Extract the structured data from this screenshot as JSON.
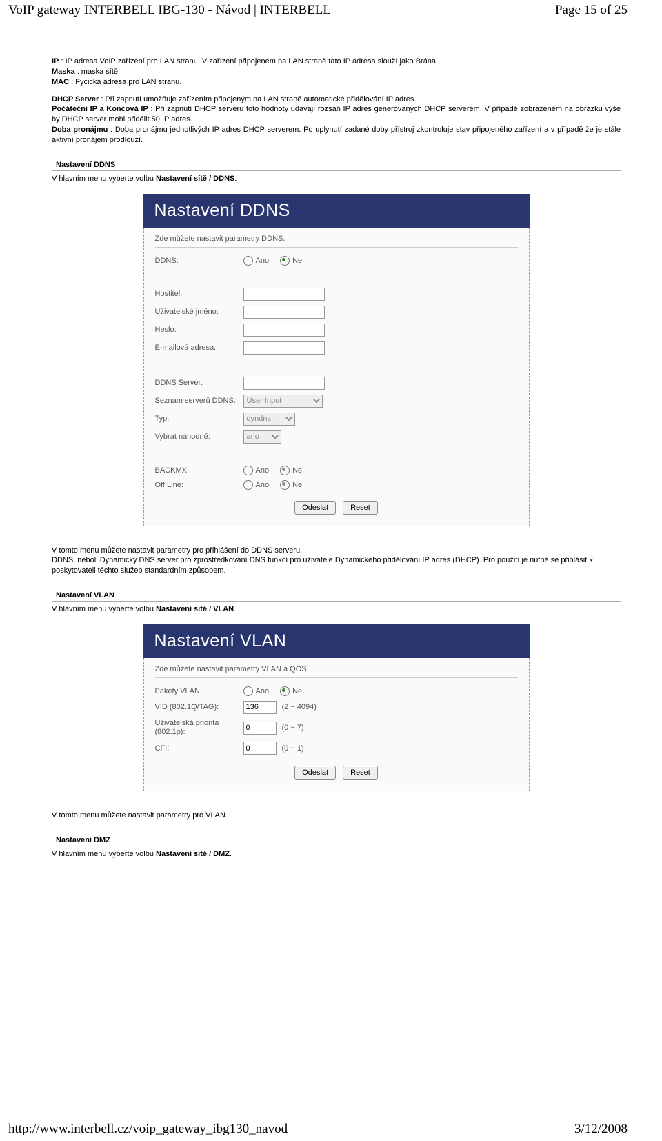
{
  "header": {
    "title": "VoIP gateway INTERBELL IBG-130 - Návod | INTERBELL",
    "page": "Page 15 of 25"
  },
  "intro": {
    "ip_label": "IP",
    "ip_text": " : IP adresa VoIP zařízení pro LAN stranu. V zařízení připojeném na LAN straně tato IP adresa slouží jako Brána.",
    "mask_label": "Maska",
    "mask_text": " : maska sítě.",
    "mac_label": "MAC",
    "mac_text": " : Fycická adresa pro LAN stranu.",
    "dhcp_label": "DHCP Server",
    "dhcp_text": " : Při zapnutí umožňuje zařízením připojeným na LAN straně automatické přidělování IP adres.",
    "range_label": "Počáteční IP a Koncová IP",
    "range_text": " : Při zapnutí DHCP serveru toto hodnoty udávají rozsah IP adres generovaných DHCP serverem. V případě zobrazeném na obrázku výše by DHCP server mohl přidělit 50 IP adres.",
    "lease_label": "Doba pronájmu",
    "lease_text": " : Doba pronájmu jednotlivých IP adres DHCP serverem. Po uplynutí zadané doby přístroj zkontroluje stav připojeného zařízení a v případě že je stále aktivní pronájem prodlouží."
  },
  "ddns": {
    "title": "Nastavení DDNS",
    "subtitle_pre": "V hlavním menu vyberte volbu ",
    "subtitle_bold": "Nastavení sítě / DDNS",
    "panel": {
      "heading": "Nastavení DDNS",
      "hint": "Zde můžete nastavit parametry DDNS.",
      "ddns_label": "DDNS:",
      "ano": "Ano",
      "ne": "Ne",
      "host": "Hostitel:",
      "user": "Uživatelské jméno:",
      "pass": "Heslo:",
      "email": "E-mailová adresa:",
      "server": "DDNS Server:",
      "list": "Seznam serverů DDNS:",
      "list_val": "User Input",
      "type": "Typ:",
      "type_val": "dyndns",
      "random": "Vybrat náhodně:",
      "random_val": "ano",
      "backmx": "BACKMX:",
      "offline": "Off Line:",
      "submit": "Odeslat",
      "reset": "Reset"
    },
    "para1": "V tomto menu můžete nastavit parametry pro přihlášení do DDNS serveru.",
    "para2": "DDNS, neboli Dynamický DNS server pro zprostředkování DNS funkcí pro uživatele Dynamického přidělování IP adres (DHCP). Pro použití je nutné se přihlásit k poskytovateli těchto služeb standardním způsobem."
  },
  "vlan": {
    "title": "Nastavení VLAN",
    "subtitle_pre": "V hlavním menu vyberte volbu ",
    "subtitle_bold": "Nastavení sítě / VLAN",
    "panel": {
      "heading": "Nastavení VLAN",
      "hint": "Zde můžete nastavit parametry VLAN a QOS.",
      "packets": "Pakety VLAN:",
      "ano": "Ano",
      "ne": "Ne",
      "vid": "VID (802.1Q/TAG):",
      "vid_val": "136",
      "vid_range": "(2 ~ 4094)",
      "prio": "Uživatelská priorita (802.1p):",
      "prio_val": "0",
      "prio_range": "(0 ~ 7)",
      "cfi": "CFI:",
      "cfi_val": "0",
      "cfi_range": "(0 ~ 1)",
      "submit": "Odeslat",
      "reset": "Reset"
    },
    "para1": "V tomto menu můžete nastavit parametry pro VLAN."
  },
  "dmz": {
    "title": "Nastavení DMZ",
    "subtitle_pre": "V hlavním menu vyberte volbu ",
    "subtitle_bold": "Nastavení sítě / DMZ"
  },
  "footer": {
    "url": "http://www.interbell.cz/voip_gateway_ibg130_navod",
    "date": "3/12/2008"
  }
}
